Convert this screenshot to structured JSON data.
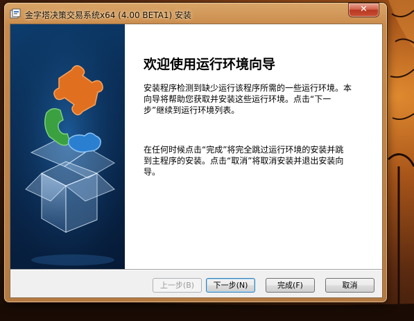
{
  "window": {
    "title": "金字塔决策交易系统x64 (4.00 BETA1) 安装",
    "close_label": "✕"
  },
  "wizard": {
    "heading": "欢迎使用运行环境向导",
    "paragraph1": "安装程序检测到缺少运行该程序所需的一些运行环境。本向导将帮助您获取并安装这些运行环境。点击“下一步”继续到运行环境列表。",
    "paragraph2": "在任何时候点击“完成”将完全跳过运行环境的安装并跳到主程序的安装。点击“取消”将取消安装并退出安装向导。"
  },
  "buttons": {
    "back": "上一步(B)",
    "next": "下一步(N)",
    "finish": "完成(F)",
    "cancel": "取消"
  },
  "colors": {
    "banner_blue": "#0a2d55",
    "puzzle_orange": "#e07020",
    "puzzle_green": "#3aa040",
    "puzzle_blue": "#2a7fd0"
  },
  "icons": {
    "app": "installer-icon",
    "banner": "puzzle-box-icon"
  }
}
